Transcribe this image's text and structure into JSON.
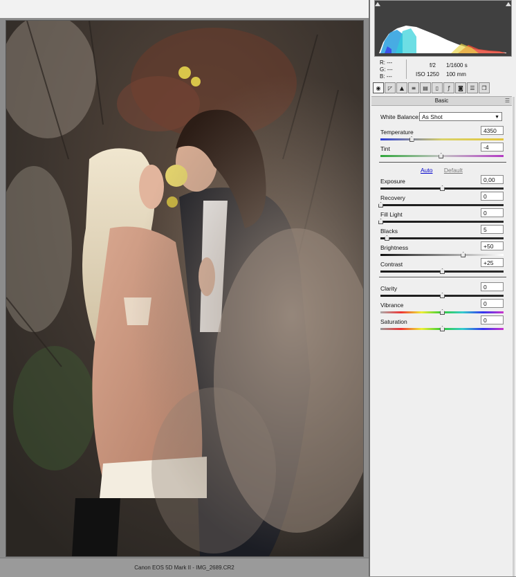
{
  "status": {
    "filename": "Canon EOS 5D Mark II  -  IMG_2689.CR2"
  },
  "readout": {
    "r": "R:  ---",
    "g": "G:  ---",
    "b": "B:  ---",
    "aperture": "f/2",
    "shutter": "1/1600 s",
    "iso": "ISO 1250",
    "focal": "100 mm"
  },
  "panel": {
    "title": "Basic",
    "white_balance_label": "White Balance:",
    "white_balance_value": "As Shot",
    "auto_link": "Auto",
    "default_link": "Default"
  },
  "controls": [
    {
      "label": "Temperature",
      "value": "4350",
      "level": 0.25,
      "track": "temp"
    },
    {
      "label": "Tint",
      "value": "-4",
      "level": 0.49,
      "track": "tint"
    },
    {
      "label": "Exposure",
      "value": "0,00",
      "level": 0.5,
      "track": "dark"
    },
    {
      "label": "Recovery",
      "value": "0",
      "level": 0.0,
      "track": "dark"
    },
    {
      "label": "Fill Light",
      "value": "0",
      "level": 0.0,
      "track": "dark"
    },
    {
      "label": "Blacks",
      "value": "5",
      "level": 0.05,
      "track": "dark"
    },
    {
      "label": "Brightness",
      "value": "+50",
      "level": 0.67,
      "track": "bright"
    },
    {
      "label": "Contrast",
      "value": "+25",
      "level": 0.5,
      "track": "dark"
    },
    {
      "label": "Clarity",
      "value": "0",
      "level": 0.5,
      "track": "dark"
    },
    {
      "label": "Vibrance",
      "value": "0",
      "level": 0.5,
      "track": "vib"
    },
    {
      "label": "Saturation",
      "value": "0",
      "level": 0.5,
      "track": "sat"
    }
  ],
  "toolbar_icons": [
    "basic-icon",
    "tone-curve-icon",
    "detail-icon",
    "hsl-icon",
    "split-toning-icon",
    "lens-corrections-icon",
    "effects-icon",
    "camera-calibration-icon",
    "presets-icon",
    "snapshots-icon"
  ]
}
